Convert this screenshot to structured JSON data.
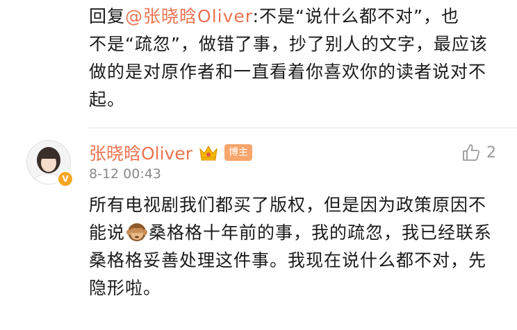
{
  "reply": {
    "prefix": "回复",
    "mention": "@张晓晗Oliver",
    "text_line1": ":不是“说什么都不对”，也",
    "text_rest": "不是“疏忽”，做错了事，抄了别人的文字，最应该做的是对原作者和一直看着你喜欢你的读者说对不起。"
  },
  "comment": {
    "username": "张晓晗Oliver",
    "role_badge": "博主",
    "time": "8-12 00:43",
    "like_count": "2",
    "text_part1": "所有电视剧我们都买了版权，但是因为政策原因不能说",
    "emoji": "monkey-see-no-evil",
    "text_part2": "桑格格十年前的事，我的疏忽，我已经联系桑格格妥善处理这件事。我现在说什么都不对，先隐形啦。"
  },
  "colors": {
    "accent": "#eb7350",
    "meta": "#888888",
    "badge": "#f7a56b"
  }
}
